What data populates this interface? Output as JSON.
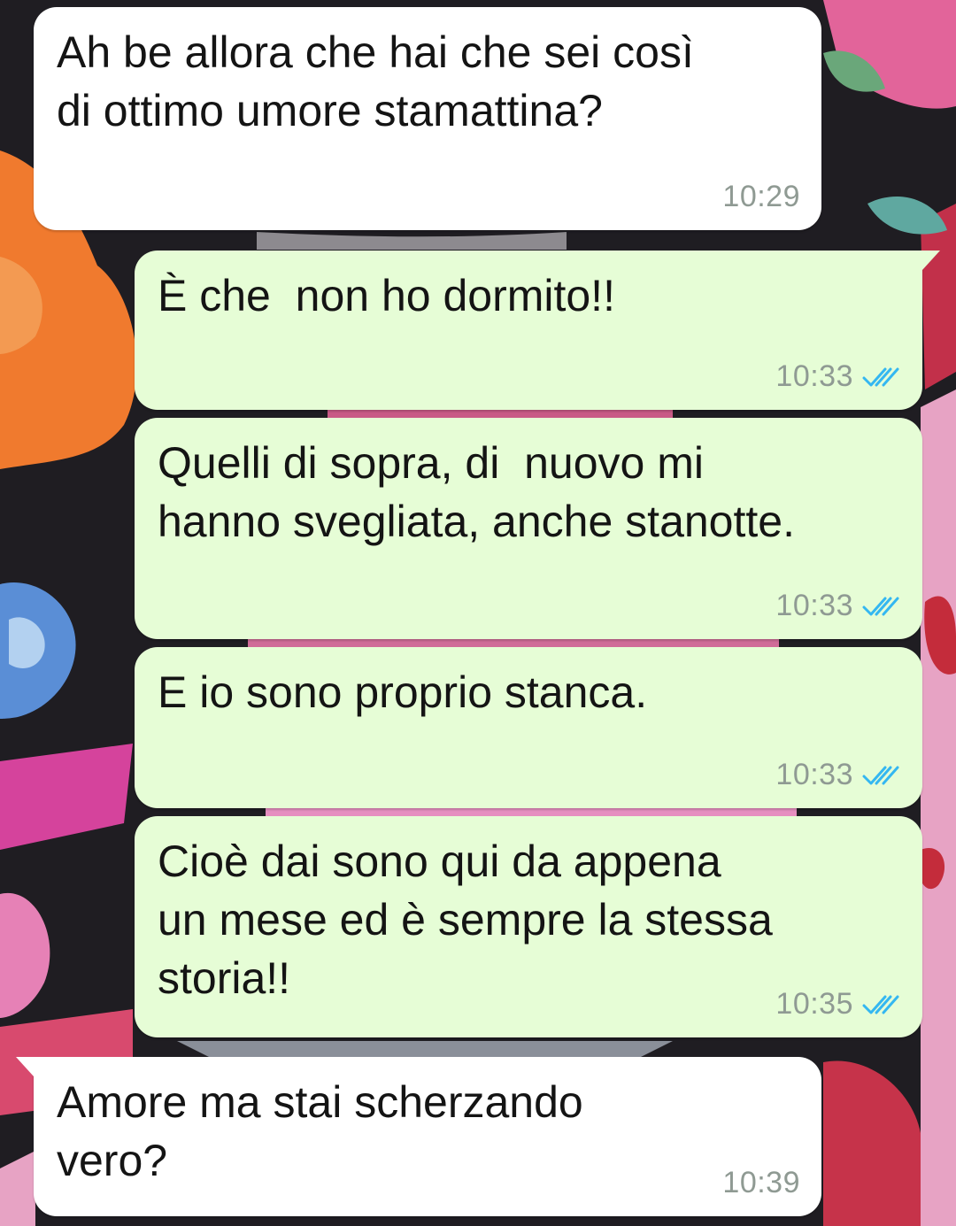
{
  "colors": {
    "incoming_bubble": "#ffffff",
    "outgoing_bubble": "#e6fdd6",
    "timestamp": "#8f9a93",
    "read_ticks": "#34b7f1",
    "text": "#141414"
  },
  "messages": [
    {
      "direction": "incoming",
      "text": "Ah be allora che hai che sei così\ndi ottimo umore stamattina?",
      "time": "10:29"
    },
    {
      "direction": "outgoing",
      "text": "È che  non ho dormito!!",
      "time": "10:33",
      "status": "read"
    },
    {
      "direction": "outgoing",
      "text": "Quelli di sopra, di  nuovo mi\nhanno svegliata, anche stanotte.",
      "time": "10:33",
      "status": "read"
    },
    {
      "direction": "outgoing",
      "text": "E io sono proprio stanca.",
      "time": "10:33",
      "status": "read"
    },
    {
      "direction": "outgoing",
      "text": "Cioè dai sono qui da appena\nun mese ed è sempre la stessa\nstoria!!",
      "time": "10:35",
      "status": "read"
    },
    {
      "direction": "incoming",
      "text": "Amore ma stai scherzando\nvero?",
      "time": "10:39"
    }
  ],
  "icons": {
    "read_receipt": "double-check-icon"
  }
}
